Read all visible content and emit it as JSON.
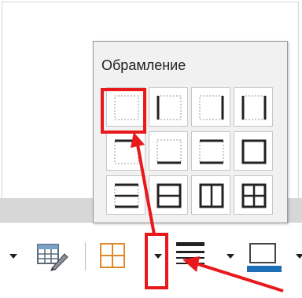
{
  "popup": {
    "title": "Обрамление",
    "presets": [
      {
        "icon": "no-borders-icon"
      },
      {
        "icon": "left-border-icon"
      },
      {
        "icon": "right-border-icon"
      },
      {
        "icon": "left-right-borders-icon"
      },
      {
        "icon": "top-border-icon"
      },
      {
        "icon": "bottom-border-icon"
      },
      {
        "icon": "top-bottom-borders-icon"
      },
      {
        "icon": "outer-border-icon"
      },
      {
        "icon": "outer-horizontal-inner-icon"
      },
      {
        "icon": "outer-all-inner-icon"
      },
      {
        "icon": "outer-vertical-inner-icon"
      },
      {
        "icon": "outer-grid-icon"
      }
    ]
  },
  "toolbar": {
    "items": [
      {
        "icon": "dropdown-arrow-icon"
      },
      {
        "icon": "table-properties-icon"
      },
      {
        "icon": "borders-icon"
      },
      {
        "icon": "borders-dropdown-arrow-icon"
      },
      {
        "icon": "border-style-icon"
      },
      {
        "icon": "border-style-dropdown-arrow-icon"
      },
      {
        "icon": "border-color-icon"
      },
      {
        "icon": "border-color-dropdown-arrow-icon"
      }
    ]
  },
  "colors": {
    "annotation_red": "#e8191b",
    "border_color_blue": "#1f6fb8",
    "borders_orange": "#e0892b"
  }
}
